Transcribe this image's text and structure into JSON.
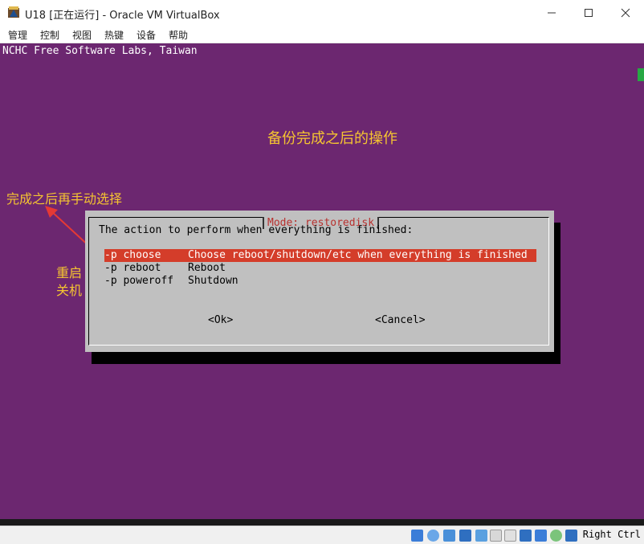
{
  "window": {
    "title": "U18 [正在运行] - Oracle VM VirtualBox",
    "icons": [
      "virtualbox-icon",
      "minimize-icon",
      "maximize-icon",
      "close-icon"
    ]
  },
  "menu": {
    "items": [
      "管理",
      "控制",
      "视图",
      "热键",
      "设备",
      "帮助"
    ]
  },
  "vm": {
    "banner": "NCHC Free Software Labs, Taiwan",
    "annotations": {
      "title": "备份完成之后的操作",
      "choose_note": "完成之后再手动选择",
      "reboot_note_line1": "重启",
      "reboot_note_line2": "关机"
    },
    "annotation_color": "#f5c431",
    "background_color": "#6c2770",
    "dialog": {
      "title": "Mode: restoredisk",
      "prompt": "The action to perform when everything is finished:",
      "options": [
        {
          "tag": "-p choose",
          "desc": "Choose reboot/shutdown/etc when everything is finished",
          "selected": true
        },
        {
          "tag": "-p reboot",
          "desc": "Reboot",
          "selected": false
        },
        {
          "tag": "-p poweroff",
          "desc": "Shutdown",
          "selected": false
        }
      ],
      "ok_label": "<Ok>",
      "cancel_label": "<Cancel>",
      "selection_color": "#d43d2a"
    }
  },
  "statusbar": {
    "icons": [
      "hard-disk-icon",
      "optical-drive-icon",
      "audio-icon",
      "network-icon",
      "usb-icon",
      "shared-folder-icon",
      "display-icon",
      "video-capture-icon",
      "virtualization-icon",
      "mouse-integration-icon",
      "keyboard-capture-icon"
    ],
    "host_key": "Right Ctrl"
  }
}
